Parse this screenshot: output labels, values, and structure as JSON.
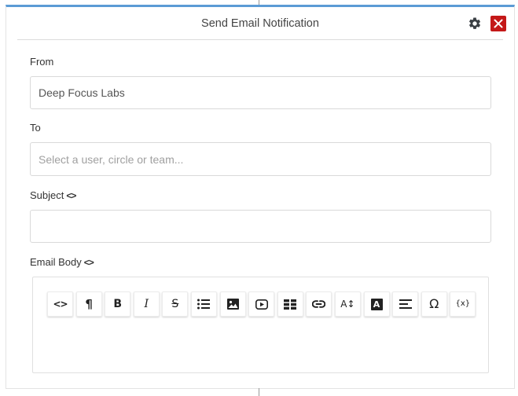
{
  "dialog": {
    "title": "Send Email Notification",
    "accent_color": "#5b9bd5",
    "close_color": "#c41818",
    "settings_icon": "gear-icon",
    "close_icon": "close-icon"
  },
  "form": {
    "from": {
      "label": "From",
      "value": "Deep Focus Labs"
    },
    "to": {
      "label": "To",
      "value": "",
      "placeholder": "Select a user, circle or team..."
    },
    "subject": {
      "label": "Subject",
      "code_icon": "<>",
      "value": ""
    },
    "body": {
      "label": "Email Body",
      "code_icon": "<>"
    }
  },
  "toolbar": [
    {
      "icon": "code-view-icon",
      "text": "<>"
    },
    {
      "icon": "paragraph-icon",
      "text": "¶"
    },
    {
      "icon": "bold-icon",
      "text": "B"
    },
    {
      "icon": "italic-icon",
      "text": "I"
    },
    {
      "icon": "strikethrough-icon",
      "text": "S"
    },
    {
      "icon": "bullet-list-icon"
    },
    {
      "icon": "image-icon"
    },
    {
      "icon": "video-icon"
    },
    {
      "icon": "table-icon"
    },
    {
      "icon": "link-icon"
    },
    {
      "icon": "font-size-icon",
      "text": "A↕"
    },
    {
      "icon": "font-color-icon",
      "text": "A"
    },
    {
      "icon": "align-left-icon"
    },
    {
      "icon": "special-character-icon",
      "text": "Ω"
    },
    {
      "icon": "variable-icon",
      "text": "{x}"
    }
  ]
}
